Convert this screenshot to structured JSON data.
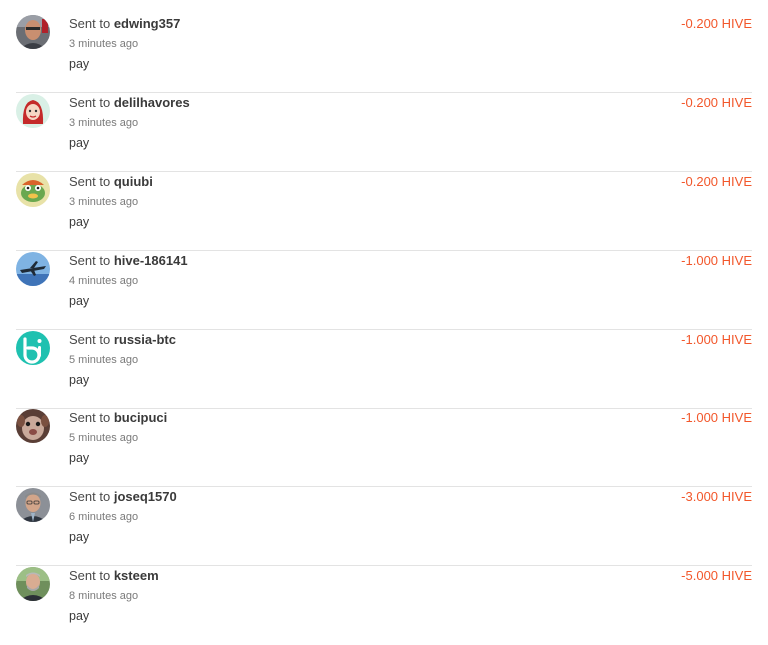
{
  "transfers": [
    {
      "prefix": "Sent to",
      "user": "edwing357",
      "time": "3 minutes ago",
      "memo": "pay",
      "amount": "-0.200 HIVE",
      "avatar_icon": "user-avatar-icon"
    },
    {
      "prefix": "Sent to",
      "user": "delilhavores",
      "time": "3 minutes ago",
      "memo": "pay",
      "amount": "-0.200 HIVE",
      "avatar_icon": "user-avatar-icon"
    },
    {
      "prefix": "Sent to",
      "user": "quiubi",
      "time": "3 minutes ago",
      "memo": "pay",
      "amount": "-0.200 HIVE",
      "avatar_icon": "user-avatar-icon"
    },
    {
      "prefix": "Sent to",
      "user": "hive-186141",
      "time": "4 minutes ago",
      "memo": "pay",
      "amount": "-1.000 HIVE",
      "avatar_icon": "user-avatar-icon"
    },
    {
      "prefix": "Sent to",
      "user": "russia-btc",
      "time": "5 minutes ago",
      "memo": "pay",
      "amount": "-1.000 HIVE",
      "avatar_icon": "user-avatar-icon"
    },
    {
      "prefix": "Sent to",
      "user": "bucipuci",
      "time": "5 minutes ago",
      "memo": "pay",
      "amount": "-1.000 HIVE",
      "avatar_icon": "user-avatar-icon"
    },
    {
      "prefix": "Sent to",
      "user": "joseq1570",
      "time": "6 minutes ago",
      "memo": "pay",
      "amount": "-3.000 HIVE",
      "avatar_icon": "user-avatar-icon"
    },
    {
      "prefix": "Sent to",
      "user": "ksteem",
      "time": "8 minutes ago",
      "memo": "pay",
      "amount": "-5.000 HIVE",
      "avatar_icon": "user-avatar-icon"
    }
  ],
  "colors": {
    "amount": "#f2572b",
    "divider": "#e3e3e3"
  }
}
